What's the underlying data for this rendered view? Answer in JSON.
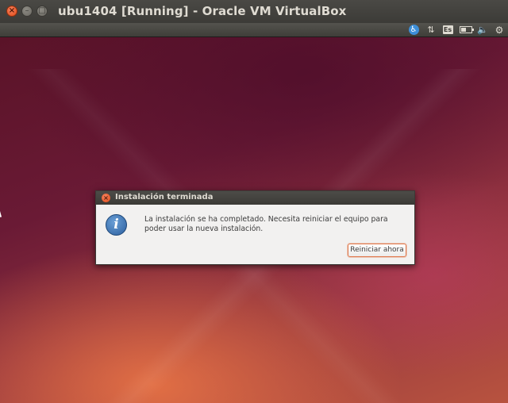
{
  "window": {
    "title": "ubu1404 [Running] - Oracle VM VirtualBox",
    "close_glyph": "×",
    "minimize_glyph": "–",
    "maximize_glyph": "□"
  },
  "panel": {
    "indicators": [
      {
        "name": "accessibility-icon",
        "glyph": "♿"
      },
      {
        "name": "network-icon",
        "glyph": "⇅"
      },
      {
        "name": "keyboard-layout-indicator",
        "label": "Es"
      },
      {
        "name": "battery-icon"
      },
      {
        "name": "volume-icon",
        "glyph": "🔈"
      },
      {
        "name": "settings-gear-icon",
        "glyph": "⚙"
      }
    ],
    "keyboard_label": "Es"
  },
  "dialog": {
    "title": "Instalación terminada",
    "close_glyph": "×",
    "icon": "info-icon",
    "icon_glyph": "i",
    "message": "La instalación se ha completado. Necesita reiniciar el equipo para poder usar la nueva instalación.",
    "button_label": "Reiniciar ahora"
  },
  "colors": {
    "accent_orange": "#df4a16",
    "panel_dark": "#3c3b37",
    "dialog_bg": "#f2f1f0"
  }
}
